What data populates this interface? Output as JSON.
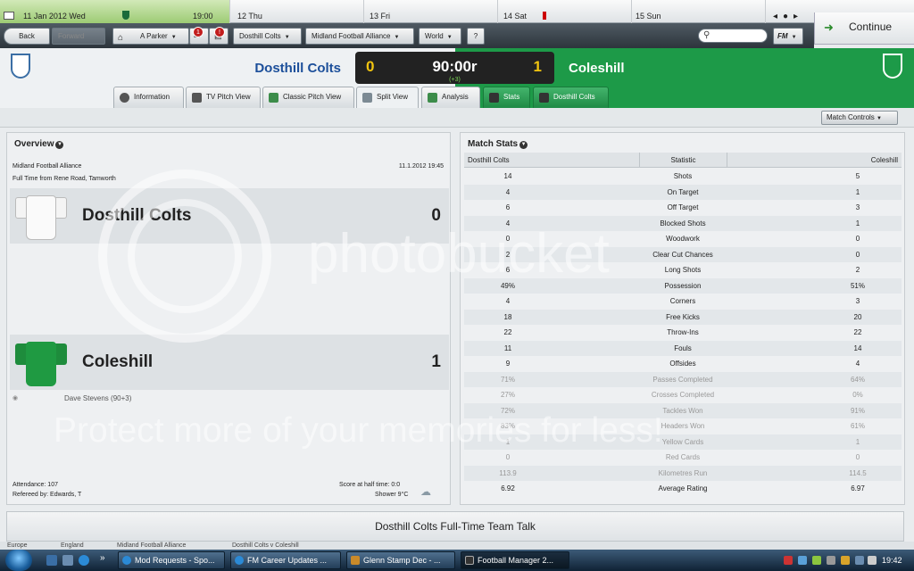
{
  "calendar": {
    "today": "11 Jan 2012  Wed",
    "today_time": "19:00",
    "days": [
      "12  Thu",
      "13  Fri",
      "14  Sat",
      "15  Sun"
    ]
  },
  "continue_label": "Continue",
  "toolbar": {
    "back": "Back",
    "forward": "Forward",
    "manager": "A Parker",
    "messages_badge": "1",
    "alerts_badge": "!",
    "club": "Dosthill Colts",
    "league": "Midland Football Alliance",
    "world": "World",
    "fm": "FM"
  },
  "match": {
    "home_team": "Dosthill Colts",
    "away_team": "Coleshill",
    "home_score": "0",
    "away_score": "1",
    "clock": "90:00r",
    "added_time": "(+3)"
  },
  "tabs": [
    "Information",
    "TV Pitch View",
    "Classic Pitch View",
    "Split View",
    "Analysis",
    "Stats",
    "Dosthill Colts"
  ],
  "match_controls": "Match Controls",
  "overview": {
    "title": "Overview",
    "competition": "Midland Football Alliance",
    "date": "11.1.2012 19:45",
    "venue": "Full Time from Rene Road, Tamworth",
    "home_team": "Dosthill Colts",
    "home_score": "0",
    "away_team": "Coleshill",
    "away_score": "1",
    "scorer": "Dave Stevens (90+3)",
    "attendance": "Attendance: 107",
    "referee": "Refereed by: Edwards, T",
    "halftime": "Score at half time: 0:0",
    "weather": "Shower 9°C"
  },
  "stats": {
    "title": "Match Stats",
    "headers": [
      "Dosthill Colts",
      "Statistic",
      "Coleshill"
    ],
    "rows": [
      {
        "home": "14",
        "stat": "Shots",
        "away": "5"
      },
      {
        "home": "4",
        "stat": "On Target",
        "away": "1"
      },
      {
        "home": "6",
        "stat": "Off Target",
        "away": "3"
      },
      {
        "home": "4",
        "stat": "Blocked Shots",
        "away": "1"
      },
      {
        "home": "0",
        "stat": "Woodwork",
        "away": "0"
      },
      {
        "home": "2",
        "stat": "Clear Cut Chances",
        "away": "0"
      },
      {
        "home": "6",
        "stat": "Long Shots",
        "away": "2"
      },
      {
        "home": "49%",
        "stat": "Possession",
        "away": "51%"
      },
      {
        "home": "4",
        "stat": "Corners",
        "away": "3"
      },
      {
        "home": "18",
        "stat": "Free Kicks",
        "away": "20"
      },
      {
        "home": "22",
        "stat": "Throw-Ins",
        "away": "22"
      },
      {
        "home": "11",
        "stat": "Fouls",
        "away": "14"
      },
      {
        "home": "9",
        "stat": "Offsides",
        "away": "4"
      },
      {
        "home": "71%",
        "stat": "Passes Completed",
        "away": "64%"
      },
      {
        "home": "27%",
        "stat": "Crosses Completed",
        "away": "0%"
      },
      {
        "home": "72%",
        "stat": "Tackles Won",
        "away": "91%"
      },
      {
        "home": "83%",
        "stat": "Headers Won",
        "away": "61%"
      },
      {
        "home": "1",
        "stat": "Yellow Cards",
        "away": "1"
      },
      {
        "home": "0",
        "stat": "Red Cards",
        "away": "0"
      },
      {
        "home": "113.9",
        "stat": "Kilometres Run",
        "away": "114.5"
      },
      {
        "home": "6.92",
        "stat": "Average Rating",
        "away": "6.97"
      }
    ]
  },
  "team_talk": "Dosthill Colts Full-Time Team Talk",
  "breadcrumb": [
    "Europe",
    "England",
    "Midland Football Alliance",
    "Dosthill Colts v Coleshill"
  ],
  "taskbar": {
    "tasks": [
      "Mod Requests - Spo...",
      "FM Career Updates ...",
      "Glenn Stamp Dec - ...",
      "Football Manager 2..."
    ],
    "time": "19:42"
  },
  "watermark": {
    "brand": "photobucket",
    "tagline": "Protect more of your memories for less!"
  },
  "colors": {
    "home_blue": "#1c4f9a",
    "away_green": "#1d9a48",
    "score_yellow": "#f1c40f"
  }
}
